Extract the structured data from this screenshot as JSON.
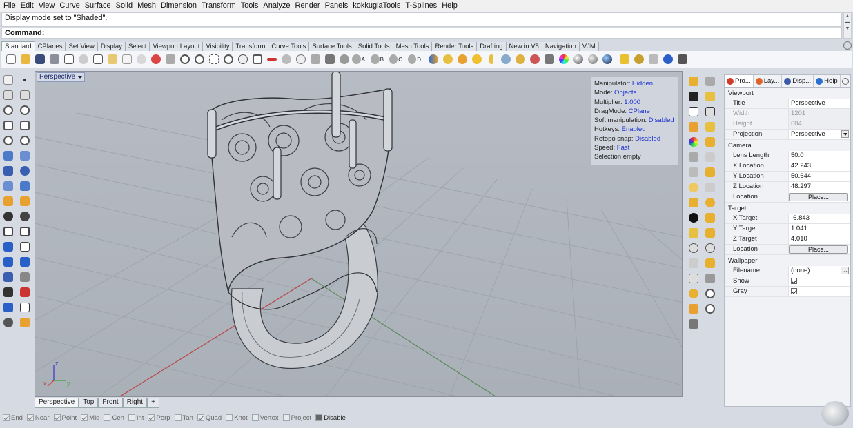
{
  "menubar": {
    "items": [
      "File",
      "Edit",
      "View",
      "Curve",
      "Surface",
      "Solid",
      "Mesh",
      "Dimension",
      "Transform",
      "Tools",
      "Analyze",
      "Render",
      "Panels",
      "kokkugiaTools",
      "T-Splines",
      "Help"
    ]
  },
  "command": {
    "history": "Display mode set to \"Shaded\".",
    "prompt": "Command:"
  },
  "toolbar_tabs": {
    "items": [
      "Standard",
      "CPlanes",
      "Set View",
      "Display",
      "Select",
      "Viewport Layout",
      "Visibility",
      "Transform",
      "Curve Tools",
      "Surface Tools",
      "Solid Tools",
      "Mesh Tools",
      "Render Tools",
      "Drafting",
      "New in V5",
      "Navigation",
      "VJM"
    ],
    "active": "Standard"
  },
  "toolbar_top": {
    "letter_labels": [
      "A",
      "B",
      "C",
      "D"
    ]
  },
  "viewport": {
    "name": "Perspective",
    "axis_labels": {
      "z": "z",
      "x": "x",
      "y": "y"
    }
  },
  "gumball_info": {
    "rows": [
      {
        "key": "Manipulator:",
        "value": "Hidden"
      },
      {
        "key": "Mode:",
        "value": "Objects"
      },
      {
        "key": "Multiplier:",
        "value": "1.000"
      },
      {
        "key": "DragMode:",
        "value": "CPlane"
      },
      {
        "key": "Soft manipulation:",
        "value": "Disabled"
      },
      {
        "key": "Hotkeys:",
        "value": "Enabled"
      },
      {
        "key": "Retopo snap:",
        "value": "Disabled"
      },
      {
        "key": "Speed:",
        "value": "Fast"
      },
      {
        "key": "Selection empty",
        "value": ""
      }
    ]
  },
  "viewport_tabs": {
    "items": [
      "Perspective",
      "Top",
      "Front",
      "Right"
    ],
    "active": "Perspective",
    "add_label": "+"
  },
  "properties": {
    "tabs": [
      {
        "label": "Pro...",
        "color": "#d0392b"
      },
      {
        "label": "Lay...",
        "color": "#e0642a"
      },
      {
        "label": "Disp...",
        "color": "#3c5aa8"
      },
      {
        "label": "Help",
        "color": "#2a6fd0"
      }
    ],
    "viewport_section": "Viewport",
    "title_key": "Title",
    "title_value": "Perspective",
    "width_key": "Width",
    "width_value": "1201",
    "height_key": "Height",
    "height_value": "604",
    "projection_key": "Projection",
    "projection_value": "Perspective",
    "camera_section": "Camera",
    "lens_key": "Lens Length",
    "lens_value": "50.0",
    "xloc_key": "X Location",
    "xloc_value": "42.243",
    "yloc_key": "Y Location",
    "yloc_value": "50.644",
    "zloc_key": "Z Location",
    "zloc_value": "48.297",
    "location_key": "Location",
    "place_label": "Place...",
    "target_section": "Target",
    "xtgt_key": "X Target",
    "xtgt_value": "-6.843",
    "ytgt_key": "Y Target",
    "ytgt_value": "1.041",
    "ztgt_key": "Z Target",
    "ztgt_value": "4.010",
    "tlocation_key": "Location",
    "tplace_label": "Place...",
    "wallpaper_section": "Wallpaper",
    "filename_key": "Filename",
    "filename_value": "(none)",
    "ellipsis_label": "...",
    "show_key": "Show",
    "gray_key": "Gray"
  },
  "osnap": {
    "items": [
      {
        "label": "End",
        "on": true
      },
      {
        "label": "Near",
        "on": true
      },
      {
        "label": "Point",
        "on": true
      },
      {
        "label": "Mid",
        "on": true
      },
      {
        "label": "Cen",
        "on": false
      },
      {
        "label": "Int",
        "on": false
      },
      {
        "label": "Perp",
        "on": true
      },
      {
        "label": "Tan",
        "on": false
      },
      {
        "label": "Quad",
        "on": true
      },
      {
        "label": "Knot",
        "on": false
      },
      {
        "label": "Vertex",
        "on": false
      },
      {
        "label": "Project",
        "on": false
      }
    ],
    "disable_label": "Disable"
  }
}
